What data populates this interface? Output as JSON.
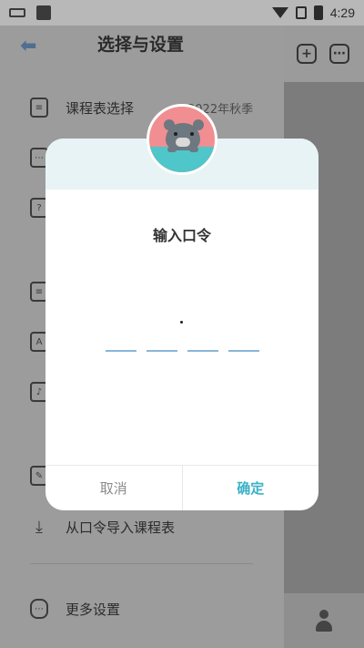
{
  "status_bar": {
    "time": "4:29"
  },
  "drawer": {
    "title": "选择与设置",
    "items": [
      {
        "icon": "clipboard-icon",
        "label": "课程表选择",
        "value": "2022年秋季"
      },
      {
        "icon": "clipboard-dots-icon",
        "label": ""
      },
      {
        "icon": "clipboard-question-icon",
        "label": ""
      },
      {
        "icon": "list-icon",
        "label": ""
      },
      {
        "icon": "font-a-icon",
        "label": ""
      },
      {
        "icon": "bell-icon",
        "label": ""
      },
      {
        "icon": "edit-icon",
        "label": ""
      },
      {
        "icon": "download-icon",
        "label": "从口令导入课程表"
      },
      {
        "icon": "more-dots-icon",
        "label": "更多设置"
      }
    ]
  },
  "dialog": {
    "title": "输入口令",
    "cancel_label": "取消",
    "ok_label": "确定",
    "slots": 4
  },
  "colors": {
    "accent": "#3ab2c8",
    "avatar_top": "#f18e91",
    "avatar_bottom": "#4fc6c9",
    "banner": "#e7f3f4"
  }
}
